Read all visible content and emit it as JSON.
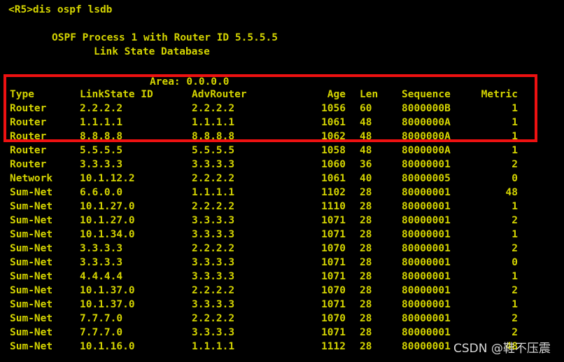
{
  "terminal": {
    "prompt_line": "<R5>dis ospf lsdb",
    "banner_process": "OSPF Process 1 with Router ID 5.5.5.5",
    "banner_database": "Link State Database",
    "area_line": "Area: 0.0.0.0",
    "background_color": "#000000",
    "text_color": "#d4d400",
    "highlight_color": "#ee1111"
  },
  "table": {
    "headers": {
      "type": "Type",
      "link_state_id": "LinkState ID",
      "adv_router": "AdvRouter",
      "age": "Age",
      "len": "Len",
      "sequence": "Sequence",
      "metric": "Metric"
    },
    "rows": [
      {
        "type": "Router",
        "link_state_id": "2.2.2.2",
        "adv_router": "2.2.2.2",
        "age": "1056",
        "len": "60",
        "sequence": "8000000B",
        "metric": "1"
      },
      {
        "type": "Router",
        "link_state_id": "1.1.1.1",
        "adv_router": "1.1.1.1",
        "age": "1061",
        "len": "48",
        "sequence": "8000000A",
        "metric": "1"
      },
      {
        "type": "Router",
        "link_state_id": "8.8.8.8",
        "adv_router": "8.8.8.8",
        "age": "1062",
        "len": "48",
        "sequence": "8000000A",
        "metric": "1"
      },
      {
        "type": "Router",
        "link_state_id": "5.5.5.5",
        "adv_router": "5.5.5.5",
        "age": "1058",
        "len": "48",
        "sequence": "8000000A",
        "metric": "1"
      },
      {
        "type": "Router",
        "link_state_id": "3.3.3.3",
        "adv_router": "3.3.3.3",
        "age": "1060",
        "len": "36",
        "sequence": "80000001",
        "metric": "2"
      },
      {
        "type": "Network",
        "link_state_id": "10.1.12.2",
        "adv_router": "2.2.2.2",
        "age": "1061",
        "len": "40",
        "sequence": "80000005",
        "metric": "0"
      },
      {
        "type": "Sum-Net",
        "link_state_id": "6.6.0.0",
        "adv_router": "1.1.1.1",
        "age": "1102",
        "len": "28",
        "sequence": "80000001",
        "metric": "48"
      },
      {
        "type": "Sum-Net",
        "link_state_id": "10.1.27.0",
        "adv_router": "2.2.2.2",
        "age": "1110",
        "len": "28",
        "sequence": "80000001",
        "metric": "1"
      },
      {
        "type": "Sum-Net",
        "link_state_id": "10.1.27.0",
        "adv_router": "3.3.3.3",
        "age": "1071",
        "len": "28",
        "sequence": "80000001",
        "metric": "2"
      },
      {
        "type": "Sum-Net",
        "link_state_id": "10.1.34.0",
        "adv_router": "3.3.3.3",
        "age": "1071",
        "len": "28",
        "sequence": "80000001",
        "metric": "1"
      },
      {
        "type": "Sum-Net",
        "link_state_id": "3.3.3.3",
        "adv_router": "2.2.2.2",
        "age": "1070",
        "len": "28",
        "sequence": "80000001",
        "metric": "2"
      },
      {
        "type": "Sum-Net",
        "link_state_id": "3.3.3.3",
        "adv_router": "3.3.3.3",
        "age": "1071",
        "len": "28",
        "sequence": "80000001",
        "metric": "0"
      },
      {
        "type": "Sum-Net",
        "link_state_id": "4.4.4.4",
        "adv_router": "3.3.3.3",
        "age": "1071",
        "len": "28",
        "sequence": "80000001",
        "metric": "1"
      },
      {
        "type": "Sum-Net",
        "link_state_id": "10.1.37.0",
        "adv_router": "2.2.2.2",
        "age": "1070",
        "len": "28",
        "sequence": "80000001",
        "metric": "2"
      },
      {
        "type": "Sum-Net",
        "link_state_id": "10.1.37.0",
        "adv_router": "3.3.3.3",
        "age": "1071",
        "len": "28",
        "sequence": "80000001",
        "metric": "1"
      },
      {
        "type": "Sum-Net",
        "link_state_id": "7.7.7.0",
        "adv_router": "2.2.2.2",
        "age": "1070",
        "len": "28",
        "sequence": "80000001",
        "metric": "2"
      },
      {
        "type": "Sum-Net",
        "link_state_id": "7.7.7.0",
        "adv_router": "3.3.3.3",
        "age": "1071",
        "len": "28",
        "sequence": "80000001",
        "metric": "2"
      },
      {
        "type": "Sum-Net",
        "link_state_id": "10.1.16.0",
        "adv_router": "1.1.1.1",
        "age": "1112",
        "len": "28",
        "sequence": "80000001",
        "metric": "48"
      }
    ]
  },
  "watermark": {
    "text": "CSDN @鞋不压震"
  }
}
